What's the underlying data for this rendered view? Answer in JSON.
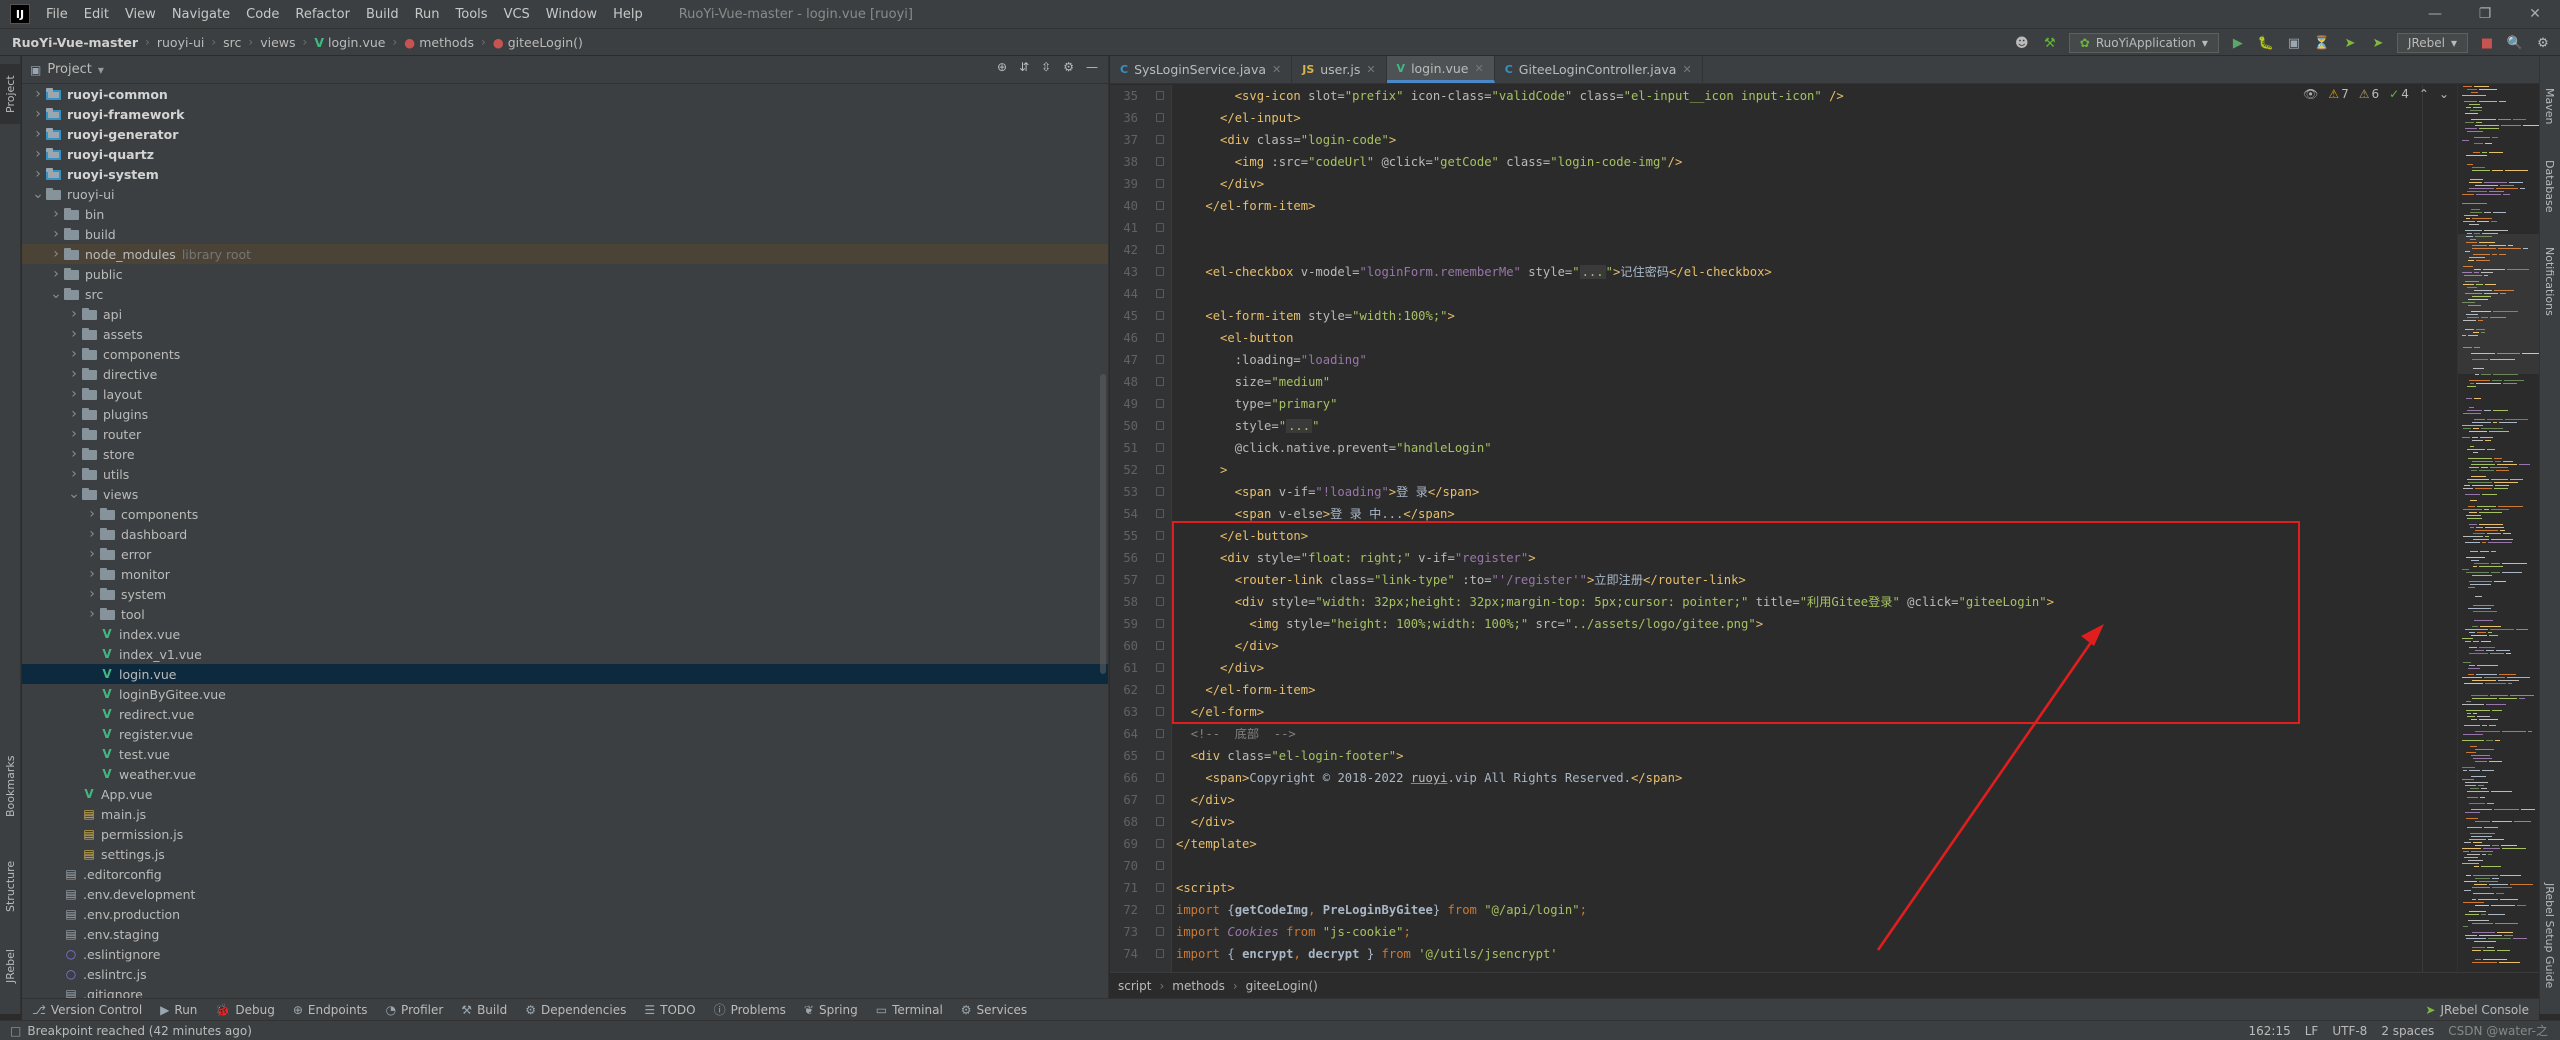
{
  "window": {
    "title": "RuoYi-Vue-master - login.vue [ruoyi]",
    "menu": [
      "File",
      "Edit",
      "View",
      "Navigate",
      "Code",
      "Refactor",
      "Build",
      "Run",
      "Tools",
      "VCS",
      "Window",
      "Help"
    ]
  },
  "breadcrumb": [
    "RuoYi-Vue-master",
    "ruoyi-ui",
    "src",
    "views",
    "login.vue",
    "methods",
    "giteeLogin()"
  ],
  "toolbar": {
    "run_config": "RuoYiApplication",
    "jrebel": "JRebel"
  },
  "project": {
    "title": "Project",
    "tree": [
      {
        "label": "ruoyi-common",
        "depth": 1,
        "type": "module",
        "arrow": ">",
        "bold": true
      },
      {
        "label": "ruoyi-framework",
        "depth": 1,
        "type": "module",
        "arrow": ">",
        "bold": true
      },
      {
        "label": "ruoyi-generator",
        "depth": 1,
        "type": "module",
        "arrow": ">",
        "bold": true
      },
      {
        "label": "ruoyi-quartz",
        "depth": 1,
        "type": "module",
        "arrow": ">",
        "bold": true
      },
      {
        "label": "ruoyi-system",
        "depth": 1,
        "type": "module",
        "arrow": ">",
        "bold": true
      },
      {
        "label": "ruoyi-ui",
        "depth": 1,
        "type": "folder",
        "arrow": "v"
      },
      {
        "label": "bin",
        "depth": 2,
        "type": "folder",
        "arrow": ">"
      },
      {
        "label": "build",
        "depth": 2,
        "type": "folder",
        "arrow": ">"
      },
      {
        "label": "node_modules",
        "depth": 2,
        "type": "folder",
        "arrow": ">",
        "hint": "library root",
        "libroot": true
      },
      {
        "label": "public",
        "depth": 2,
        "type": "folder",
        "arrow": ">"
      },
      {
        "label": "src",
        "depth": 2,
        "type": "folder",
        "arrow": "v"
      },
      {
        "label": "api",
        "depth": 3,
        "type": "folder",
        "arrow": ">"
      },
      {
        "label": "assets",
        "depth": 3,
        "type": "folder",
        "arrow": ">"
      },
      {
        "label": "components",
        "depth": 3,
        "type": "folder",
        "arrow": ">"
      },
      {
        "label": "directive",
        "depth": 3,
        "type": "folder",
        "arrow": ">"
      },
      {
        "label": "layout",
        "depth": 3,
        "type": "folder",
        "arrow": ">"
      },
      {
        "label": "plugins",
        "depth": 3,
        "type": "folder",
        "arrow": ">"
      },
      {
        "label": "router",
        "depth": 3,
        "type": "folder",
        "arrow": ">"
      },
      {
        "label": "store",
        "depth": 3,
        "type": "folder",
        "arrow": ">"
      },
      {
        "label": "utils",
        "depth": 3,
        "type": "folder",
        "arrow": ">"
      },
      {
        "label": "views",
        "depth": 3,
        "type": "folder",
        "arrow": "v"
      },
      {
        "label": "components",
        "depth": 4,
        "type": "folder",
        "arrow": ">"
      },
      {
        "label": "dashboard",
        "depth": 4,
        "type": "folder",
        "arrow": ">"
      },
      {
        "label": "error",
        "depth": 4,
        "type": "folder",
        "arrow": ">"
      },
      {
        "label": "monitor",
        "depth": 4,
        "type": "folder",
        "arrow": ">"
      },
      {
        "label": "system",
        "depth": 4,
        "type": "folder",
        "arrow": ">"
      },
      {
        "label": "tool",
        "depth": 4,
        "type": "folder",
        "arrow": ">"
      },
      {
        "label": "index.vue",
        "depth": 4,
        "type": "vue"
      },
      {
        "label": "index_v1.vue",
        "depth": 4,
        "type": "vue"
      },
      {
        "label": "login.vue",
        "depth": 4,
        "type": "vue",
        "selected": true
      },
      {
        "label": "loginByGitee.vue",
        "depth": 4,
        "type": "vue"
      },
      {
        "label": "redirect.vue",
        "depth": 4,
        "type": "vue"
      },
      {
        "label": "register.vue",
        "depth": 4,
        "type": "vue"
      },
      {
        "label": "test.vue",
        "depth": 4,
        "type": "vue"
      },
      {
        "label": "weather.vue",
        "depth": 4,
        "type": "vue"
      },
      {
        "label": "App.vue",
        "depth": 3,
        "type": "vue"
      },
      {
        "label": "main.js",
        "depth": 3,
        "type": "js"
      },
      {
        "label": "permission.js",
        "depth": 3,
        "type": "js"
      },
      {
        "label": "settings.js",
        "depth": 3,
        "type": "js"
      },
      {
        "label": ".editorconfig",
        "depth": 2,
        "type": "cfg"
      },
      {
        "label": ".env.development",
        "depth": 2,
        "type": "cfg"
      },
      {
        "label": ".env.production",
        "depth": 2,
        "type": "cfg"
      },
      {
        "label": ".env.staging",
        "depth": 2,
        "type": "cfg"
      },
      {
        "label": ".eslintignore",
        "depth": 2,
        "type": "ignore"
      },
      {
        "label": ".eslintrc.js",
        "depth": 2,
        "type": "ignore"
      },
      {
        "label": ".gitignore",
        "depth": 2,
        "type": "cfg"
      }
    ]
  },
  "tabs": [
    {
      "label": "SysLoginService.java",
      "icon": "C",
      "color": "#3592c4"
    },
    {
      "label": "user.js",
      "icon": "JS",
      "color": "#d6b44a"
    },
    {
      "label": "login.vue",
      "icon": "V",
      "color": "#41b883",
      "active": true
    },
    {
      "label": "GiteeLoginController.java",
      "icon": "C",
      "color": "#3592c4"
    }
  ],
  "inspections": {
    "warnings": "7",
    "weak_warnings": "6",
    "ok": "4"
  },
  "code_start_line": 35,
  "code_lines": [
    [
      [
        "        ",
        "txt"
      ],
      [
        "<svg-icon ",
        "tag"
      ],
      [
        "slot=",
        "attr"
      ],
      [
        "\"prefix\" ",
        "str"
      ],
      [
        "icon-class=",
        "attr"
      ],
      [
        "\"validCode\" ",
        "str"
      ],
      [
        "class=",
        "attr"
      ],
      [
        "\"el-input__icon input-icon\" ",
        "str"
      ],
      [
        "/>",
        "tag"
      ]
    ],
    [
      [
        "      ",
        "txt"
      ],
      [
        "</el-input>",
        "tag"
      ]
    ],
    [
      [
        "      ",
        "txt"
      ],
      [
        "<div ",
        "tag"
      ],
      [
        "class=",
        "attr"
      ],
      [
        "\"login-code\"",
        "str"
      ],
      [
        ">",
        "tag"
      ]
    ],
    [
      [
        "        ",
        "txt"
      ],
      [
        "<img ",
        "tag"
      ],
      [
        ":src=",
        "attr"
      ],
      [
        "\"codeUrl\" ",
        "str"
      ],
      [
        "@click=",
        "attr"
      ],
      [
        "\"getCode\" ",
        "str"
      ],
      [
        "class=",
        "attr"
      ],
      [
        "\"login-code-img\"",
        "str"
      ],
      [
        "/>",
        "tag"
      ]
    ],
    [
      [
        "      ",
        "txt"
      ],
      [
        "</div>",
        "tag"
      ]
    ],
    [
      [
        "    ",
        "txt"
      ],
      [
        "</el-form-item>",
        "tag"
      ]
    ],
    [
      [
        "",
        ""
      ]
    ],
    [
      [
        "",
        ""
      ]
    ],
    [
      [
        "    ",
        "txt"
      ],
      [
        "<el-checkbox ",
        "tag"
      ],
      [
        "v-model=",
        "attr"
      ],
      [
        "\"loginForm.rememberMe\" ",
        "vue"
      ],
      [
        "style=",
        "attr"
      ],
      [
        "\"",
        "str"
      ],
      [
        "...",
        "fold-str"
      ],
      [
        "\"",
        "str"
      ],
      [
        ">",
        "tag"
      ],
      [
        "记住密码",
        "txt"
      ],
      [
        "</el-checkbox>",
        "tag"
      ]
    ],
    [
      [
        "",
        ""
      ]
    ],
    [
      [
        "    ",
        "txt"
      ],
      [
        "<el-form-item ",
        "tag"
      ],
      [
        "style=",
        "attr"
      ],
      [
        "\"width:100%;\"",
        "str"
      ],
      [
        ">",
        "tag"
      ]
    ],
    [
      [
        "      ",
        "txt"
      ],
      [
        "<el-button",
        "tag"
      ]
    ],
    [
      [
        "        ",
        "txt"
      ],
      [
        ":loading=",
        "attr"
      ],
      [
        "\"loading\"",
        "vue"
      ]
    ],
    [
      [
        "        ",
        "txt"
      ],
      [
        "size=",
        "attr"
      ],
      [
        "\"medium\"",
        "str"
      ]
    ],
    [
      [
        "        ",
        "txt"
      ],
      [
        "type=",
        "attr"
      ],
      [
        "\"primary\"",
        "str"
      ]
    ],
    [
      [
        "        ",
        "txt"
      ],
      [
        "style=",
        "attr"
      ],
      [
        "\"",
        "str"
      ],
      [
        "...",
        "fold-str"
      ],
      [
        "\"",
        "str"
      ]
    ],
    [
      [
        "        ",
        "txt"
      ],
      [
        "@click.native.prevent=",
        "attr"
      ],
      [
        "\"handleLogin\"",
        "str"
      ]
    ],
    [
      [
        "      ",
        "txt"
      ],
      [
        ">",
        "tag"
      ]
    ],
    [
      [
        "        ",
        "txt"
      ],
      [
        "<span ",
        "tag"
      ],
      [
        "v-if=",
        "attr"
      ],
      [
        "\"!loading\"",
        "vue"
      ],
      [
        ">",
        "tag"
      ],
      [
        "登 录",
        "txt"
      ],
      [
        "</span>",
        "tag"
      ]
    ],
    [
      [
        "        ",
        "txt"
      ],
      [
        "<span ",
        "tag"
      ],
      [
        "v-else",
        "attr"
      ],
      [
        ">",
        "tag"
      ],
      [
        "登 录 中...",
        "txt"
      ],
      [
        "</span>",
        "tag"
      ]
    ],
    [
      [
        "      ",
        "txt"
      ],
      [
        "</el-button>",
        "tag"
      ]
    ],
    [
      [
        "      ",
        "txt"
      ],
      [
        "<div ",
        "tag"
      ],
      [
        "style=",
        "attr"
      ],
      [
        "\"float: right;\" ",
        "str"
      ],
      [
        "v-if=",
        "attr"
      ],
      [
        "\"register\"",
        "vue"
      ],
      [
        ">",
        "tag"
      ]
    ],
    [
      [
        "        ",
        "txt"
      ],
      [
        "<router-link ",
        "tag"
      ],
      [
        "class=",
        "attr"
      ],
      [
        "\"link-type\" ",
        "str"
      ],
      [
        ":to=",
        "attr"
      ],
      [
        "\"'/register'\"",
        "vue"
      ],
      [
        ">",
        "tag"
      ],
      [
        "立即注册",
        "txt"
      ],
      [
        "</router-link>",
        "tag"
      ]
    ],
    [
      [
        "        ",
        "txt"
      ],
      [
        "<div ",
        "tag"
      ],
      [
        "style=",
        "attr"
      ],
      [
        "\"width: 32px;height: 32px;margin-top: 5px;cursor: pointer;\" ",
        "str"
      ],
      [
        "title=",
        "attr"
      ],
      [
        "\"利用Gitee登录\" ",
        "str"
      ],
      [
        "@click=",
        "attr"
      ],
      [
        "\"giteeLogin\"",
        "str"
      ],
      [
        ">",
        "tag"
      ]
    ],
    [
      [
        "          ",
        "txt"
      ],
      [
        "<img ",
        "tag"
      ],
      [
        "style=",
        "attr"
      ],
      [
        "\"height: 100%;width: 100%;\" ",
        "str"
      ],
      [
        "src=",
        "attr"
      ],
      [
        "\"../assets/logo/gitee.png\"",
        "str"
      ],
      [
        ">",
        "tag"
      ]
    ],
    [
      [
        "        ",
        "txt"
      ],
      [
        "</div>",
        "tag"
      ]
    ],
    [
      [
        "      ",
        "txt"
      ],
      [
        "</div>",
        "tag"
      ]
    ],
    [
      [
        "    ",
        "txt"
      ],
      [
        "</el-form-item>",
        "tag"
      ]
    ],
    [
      [
        "  ",
        "txt"
      ],
      [
        "</el-form>",
        "tag"
      ]
    ],
    [
      [
        "  ",
        "txt"
      ],
      [
        "<!--  底部  -->",
        "cmt"
      ]
    ],
    [
      [
        "  ",
        "txt"
      ],
      [
        "<div ",
        "tag"
      ],
      [
        "class=",
        "attr"
      ],
      [
        "\"el-login-footer\"",
        "str"
      ],
      [
        ">",
        "tag"
      ]
    ],
    [
      [
        "    ",
        "txt"
      ],
      [
        "<span>",
        "tag"
      ],
      [
        "Copyright © 2018-2022 ",
        "txt"
      ],
      [
        "ruoyi",
        "undr"
      ],
      [
        ".vip All Rights Reserved.",
        "txt"
      ],
      [
        "</span>",
        "tag"
      ]
    ],
    [
      [
        "  ",
        "txt"
      ],
      [
        "</div>",
        "tag"
      ]
    ],
    [
      [
        "  ",
        "txt"
      ],
      [
        "</div>",
        "tag"
      ]
    ],
    [
      [
        "</template>",
        "tag"
      ]
    ],
    [
      [
        "",
        ""
      ]
    ],
    [
      [
        "<script>",
        "tag"
      ]
    ],
    [
      [
        "import ",
        "kw"
      ],
      [
        "{",
        "txt"
      ],
      [
        "getCodeImg",
        "imp"
      ],
      [
        ", ",
        "kw"
      ],
      [
        "PreLoginByGitee",
        "imp"
      ],
      [
        "} ",
        "txt"
      ],
      [
        "from ",
        "kw"
      ],
      [
        "\"@/api/login\"",
        "str"
      ],
      [
        ";",
        "kw"
      ]
    ],
    [
      [
        "import ",
        "kw"
      ],
      [
        "Cookies ",
        "ital"
      ],
      [
        "from ",
        "kw"
      ],
      [
        "\"js-cookie\"",
        "str"
      ],
      [
        ";",
        "kw"
      ]
    ],
    [
      [
        "import ",
        "kw"
      ],
      [
        "{ ",
        "txt"
      ],
      [
        "encrypt",
        "imp"
      ],
      [
        ", ",
        "kw"
      ],
      [
        "decrypt ",
        "imp"
      ],
      [
        "} ",
        "txt"
      ],
      [
        "from ",
        "kw"
      ],
      [
        "'@/utils/jsencrypt'",
        "str"
      ]
    ]
  ],
  "editor_breadcrumb": [
    "script",
    "methods",
    "giteeLogin()"
  ],
  "bottom_tools": [
    "Version Control",
    "Run",
    "Debug",
    "Endpoints",
    "Profiler",
    "Build",
    "Dependencies",
    "TODO",
    "Problems",
    "Spring",
    "Terminal",
    "Services"
  ],
  "jrebel_console": "JRebel Console",
  "status": {
    "message": "Breakpoint reached (42 minutes ago)",
    "position": "162:15",
    "line_sep": "LF",
    "encoding": "UTF-8",
    "indent": "2 spaces",
    "watermark": "CSDN @water-之"
  },
  "side_tabs": {
    "left": [
      "Project",
      "Bookmarks",
      "Structure",
      "JRebel"
    ],
    "right": [
      "Maven",
      "Database",
      "Notifications",
      "JRebel Setup Guide"
    ]
  },
  "colors": {
    "annotation": "#e01e1e",
    "accent": "#4a88c7",
    "selection": "#0d293e"
  }
}
